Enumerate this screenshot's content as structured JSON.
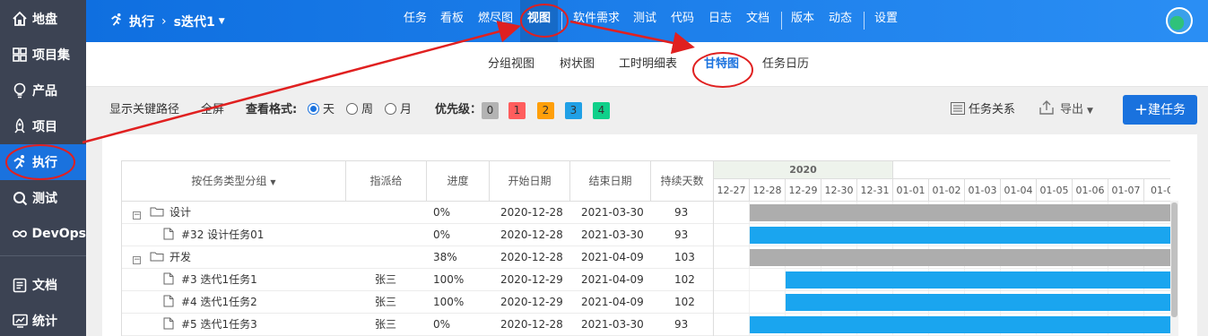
{
  "sidebar": {
    "items": [
      {
        "label": "地盘",
        "icon": "home-icon"
      },
      {
        "label": "项目集",
        "icon": "grid-icon"
      },
      {
        "label": "产品",
        "icon": "lightbulb-icon"
      },
      {
        "label": "项目",
        "icon": "rocket-icon"
      },
      {
        "label": "执行",
        "icon": "run-icon",
        "active": true
      },
      {
        "label": "测试",
        "icon": "search-icon"
      },
      {
        "label": "DevOps",
        "icon": "infinity-icon"
      },
      {
        "label": "文档",
        "icon": "doc-icon"
      },
      {
        "label": "统计",
        "icon": "chart-icon"
      }
    ]
  },
  "header": {
    "module": "执行",
    "execution": "s迭代1",
    "nav": [
      "任务",
      "看板",
      "燃尽图",
      "视图",
      "软件需求",
      "测试",
      "代码",
      "日志",
      "文档",
      "版本",
      "动态",
      "设置"
    ],
    "active_nav": "视图"
  },
  "subnav": {
    "items": [
      "分组视图",
      "树状图",
      "工时明细表",
      "甘特图",
      "任务日历"
    ],
    "active": "甘特图"
  },
  "toolbar": {
    "critical_path": "显示关键路径",
    "fullscreen": "全屏",
    "view_format_label": "查看格式:",
    "formats": [
      "天",
      "周",
      "月"
    ],
    "selected_format": "天",
    "priority_label": "优先级：",
    "priorities": [
      {
        "label": "0",
        "color": "#b3b3b3"
      },
      {
        "label": "1",
        "color": "#ff5d5d"
      },
      {
        "label": "2",
        "color": "#ff9f0a"
      },
      {
        "label": "3",
        "color": "#20a0e6"
      },
      {
        "label": "4",
        "color": "#10d08a"
      }
    ],
    "task_relation": "任务关系",
    "export": "导出",
    "new_task": "建任务"
  },
  "gantt": {
    "columns": [
      "按任务类型分组",
      "指派给",
      "进度",
      "开始日期",
      "结束日期",
      "持续天数"
    ],
    "year": "2020",
    "days": [
      "12-27",
      "12-28",
      "12-29",
      "12-30",
      "12-31",
      "01-01",
      "01-02",
      "01-03",
      "01-04",
      "01-05",
      "01-06",
      "01-07",
      "01-0"
    ],
    "rows": [
      {
        "type": "group",
        "name": "设计",
        "assignee": "",
        "progress": "0%",
        "start": "2020-12-28",
        "end": "2021-03-30",
        "days": "93",
        "bar_start_day": 1,
        "bar_color": "#adadad"
      },
      {
        "type": "task",
        "name": "#32 设计任务01",
        "assignee": "",
        "progress": "0%",
        "start": "2020-12-28",
        "end": "2021-03-30",
        "days": "93",
        "bar_start_day": 1,
        "bar_color": "#1aa5ef"
      },
      {
        "type": "group",
        "name": "开发",
        "assignee": "",
        "progress": "38%",
        "start": "2020-12-28",
        "end": "2021-04-09",
        "days": "103",
        "bar_start_day": 1,
        "bar_color": "#adadad"
      },
      {
        "type": "task",
        "name": "#3 迭代1任务1",
        "assignee": "张三",
        "progress": "100%",
        "start": "2020-12-29",
        "end": "2021-04-09",
        "days": "102",
        "bar_start_day": 2,
        "bar_color": "#1aa5ef"
      },
      {
        "type": "task",
        "name": "#4 迭代1任务2",
        "assignee": "张三",
        "progress": "100%",
        "start": "2020-12-29",
        "end": "2021-04-09",
        "days": "102",
        "bar_start_day": 2,
        "bar_color": "#1aa5ef"
      },
      {
        "type": "task",
        "name": "#5 迭代1任务3",
        "assignee": "张三",
        "progress": "0%",
        "start": "2020-12-28",
        "end": "2021-03-30",
        "days": "93",
        "bar_start_day": 1,
        "bar_color": "#1aa5ef"
      }
    ]
  },
  "colors": {
    "sidebar_bg": "#3c4353",
    "active_blue": "#1a72de",
    "annotation_red": "#e02020"
  }
}
